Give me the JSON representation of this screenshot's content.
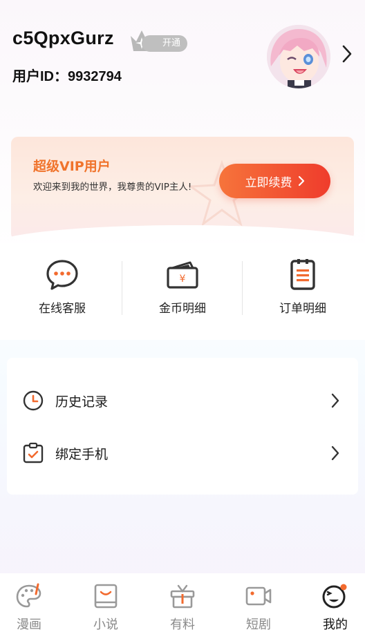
{
  "profile": {
    "username": "c5QpxGurz",
    "vip_badge_label": "开通",
    "user_id_label": "用户ID：",
    "user_id": "9932794"
  },
  "vip_banner": {
    "title": "超级VIP用户",
    "description": "欢迎来到我的世界，我尊贵的VIP主人!",
    "button_label": "立即续费",
    "accent_color": "#f0732b"
  },
  "quick_actions": [
    {
      "label": "在线客服",
      "icon": "chat-bubble-icon"
    },
    {
      "label": "金币明细",
      "icon": "wallet-icon"
    },
    {
      "label": "订单明细",
      "icon": "clipboard-list-icon"
    }
  ],
  "menu": [
    {
      "label": "历史记录",
      "icon": "clock-icon"
    },
    {
      "label": "绑定手机",
      "icon": "clipboard-check-icon"
    }
  ],
  "tabbar": {
    "items": [
      {
        "label": "漫画",
        "icon": "palette-icon",
        "active": false
      },
      {
        "label": "小说",
        "icon": "book-icon",
        "active": false
      },
      {
        "label": "有料",
        "icon": "gift-icon",
        "active": false
      },
      {
        "label": "短剧",
        "icon": "video-camera-icon",
        "active": false
      },
      {
        "label": "我的",
        "icon": "smiley-face-icon",
        "active": true
      }
    ]
  }
}
